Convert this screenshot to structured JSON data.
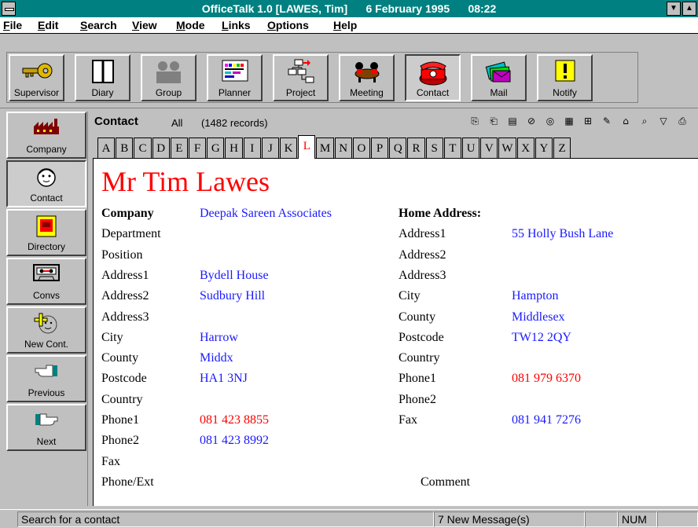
{
  "window": {
    "title": "OfficeTalk 1.0 [LAWES, Tim]      6 February 1995      08:22",
    "system_menu_icon": "system-menu-icon",
    "scroll_down_glyph": "▼",
    "maximize_glyph": "▲"
  },
  "menu": [
    {
      "label": "File",
      "u": "F"
    },
    {
      "label": "Edit",
      "u": "E"
    },
    {
      "label": "Search",
      "u": "S"
    },
    {
      "label": "View",
      "u": "V"
    },
    {
      "label": "Mode",
      "u": "M"
    },
    {
      "label": "Links",
      "u": "L"
    },
    {
      "label": "Options",
      "u": "O"
    },
    {
      "label": "Help",
      "u": "H"
    }
  ],
  "toolbar": [
    {
      "label": "Supervisor",
      "icon": "key-icon"
    },
    {
      "label": "Diary",
      "icon": "diary-icon"
    },
    {
      "label": "Group",
      "icon": "group-icon"
    },
    {
      "label": "Planner",
      "icon": "planner-icon"
    },
    {
      "label": "Project",
      "icon": "project-icon"
    },
    {
      "label": "Meeting",
      "icon": "meeting-icon"
    },
    {
      "label": "Contact",
      "icon": "telephone-icon",
      "active": true
    },
    {
      "label": "Mail",
      "icon": "mail-icon"
    },
    {
      "label": "Notify",
      "icon": "notify-icon"
    }
  ],
  "leftnav": [
    {
      "label": "Company",
      "icon": "factory-icon"
    },
    {
      "label": "Contact",
      "icon": "face-icon",
      "active": true
    },
    {
      "label": "Directory",
      "icon": "directory-icon"
    },
    {
      "label": "Convs",
      "icon": "cassette-icon"
    },
    {
      "label": "New Cont.",
      "icon": "new-contact-icon"
    },
    {
      "label": "Previous",
      "icon": "hand-left-icon"
    },
    {
      "label": "Next",
      "icon": "hand-right-icon"
    }
  ],
  "contact_header": {
    "title": "Contact",
    "filter": "All",
    "count": "(1482 records)"
  },
  "letters": [
    "A",
    "B",
    "C",
    "D",
    "E",
    "F",
    "G",
    "H",
    "I",
    "J",
    "K",
    "L",
    "M",
    "N",
    "O",
    "P",
    "Q",
    "R",
    "S",
    "T",
    "U",
    "V",
    "W",
    "X",
    "Y",
    "Z"
  ],
  "active_letter": "L",
  "contact": {
    "name": "Mr Tim Lawes",
    "company": {
      "label": "Company",
      "value": "Deepak Sareen Associates",
      "fields": [
        {
          "label": "Department",
          "value": ""
        },
        {
          "label": "Position",
          "value": ""
        },
        {
          "label": "Address1",
          "value": "Bydell House"
        },
        {
          "label": "Address2",
          "value": "Sudbury Hill"
        },
        {
          "label": "Address3",
          "value": ""
        },
        {
          "label": "City",
          "value": "Harrow"
        },
        {
          "label": "County",
          "value": "Middx"
        },
        {
          "label": "Postcode",
          "value": "HA1 3NJ"
        },
        {
          "label": "Country",
          "value": ""
        },
        {
          "label": "Phone1",
          "value": "081 423 8855",
          "red": true
        },
        {
          "label": "Phone2",
          "value": "081 423 8992"
        },
        {
          "label": "Fax",
          "value": ""
        },
        {
          "label": "Phone/Ext",
          "value": ""
        }
      ]
    },
    "home": {
      "heading": "Home Address:",
      "fields": [
        {
          "label": "Address1",
          "value": "55 Holly Bush Lane"
        },
        {
          "label": "Address2",
          "value": ""
        },
        {
          "label": "Address3",
          "value": ""
        },
        {
          "label": "City",
          "value": "Hampton"
        },
        {
          "label": "County",
          "value": "Middlesex"
        },
        {
          "label": "Postcode",
          "value": "TW12 2QY"
        },
        {
          "label": "Country",
          "value": ""
        },
        {
          "label": "Phone1",
          "value": "081 979 6370",
          "red": true
        },
        {
          "label": "Phone2",
          "value": ""
        },
        {
          "label": "Fax",
          "value": "081 941 7276"
        }
      ]
    },
    "comment_label": "Comment"
  },
  "status": {
    "message": "Search for a contact",
    "messages": "7 New Message(s)",
    "num": "NUM"
  },
  "colors": {
    "titlebar": "#008080",
    "value_blue": "#1a1aff",
    "accent_red": "#ff0000"
  }
}
